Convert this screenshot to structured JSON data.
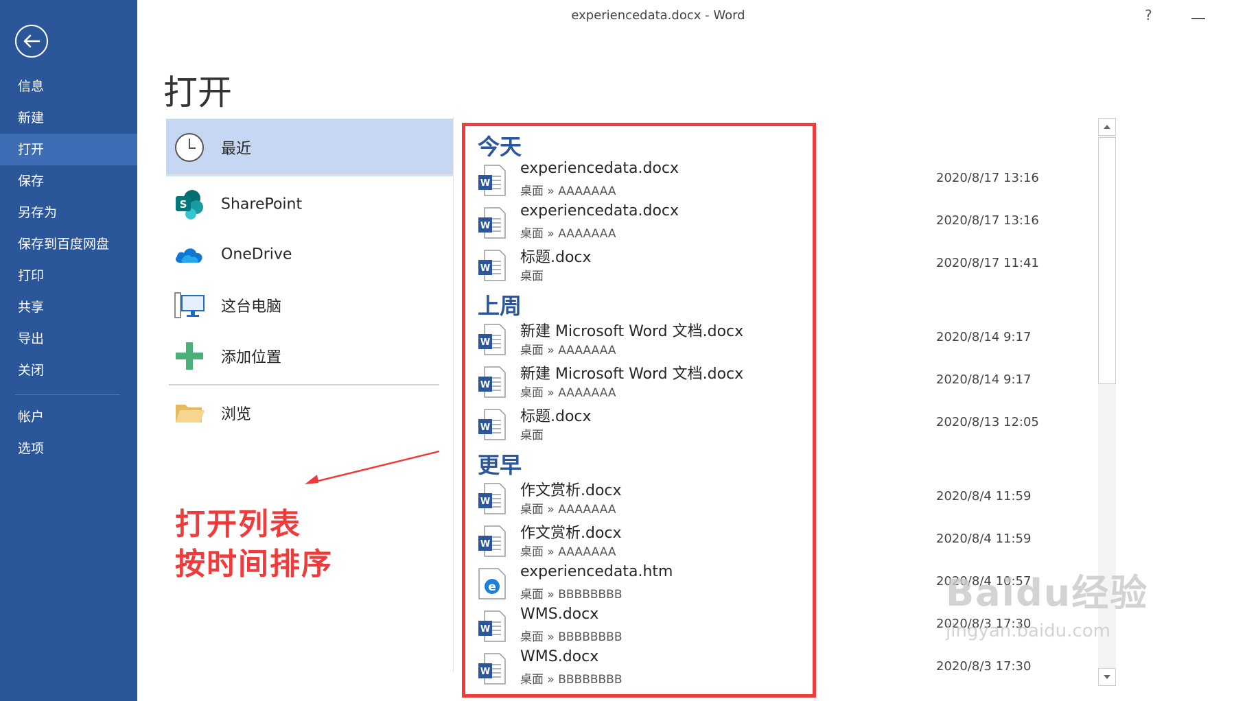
{
  "window": {
    "title": "experiencedata.docx - Word",
    "help": "?"
  },
  "nav": {
    "items": [
      {
        "label": "信息"
      },
      {
        "label": "新建"
      },
      {
        "label": "打开"
      },
      {
        "label": "保存"
      },
      {
        "label": "另存为"
      },
      {
        "label": "保存到百度网盘"
      },
      {
        "label": "打印"
      },
      {
        "label": "共享"
      },
      {
        "label": "导出"
      },
      {
        "label": "关闭"
      },
      {
        "label": "帐户"
      },
      {
        "label": "选项"
      }
    ],
    "active": "打开",
    "accent": "#2b579a"
  },
  "page": {
    "title": "打开"
  },
  "locations": [
    {
      "label": "最近",
      "icon": "clock-icon"
    },
    {
      "label": "SharePoint",
      "icon": "sharepoint-icon"
    },
    {
      "label": "OneDrive",
      "icon": "onedrive-icon"
    },
    {
      "label": "这台电脑",
      "icon": "computer-icon"
    },
    {
      "label": "添加位置",
      "icon": "plus-icon"
    },
    {
      "label": "浏览",
      "icon": "folder-icon"
    }
  ],
  "annotation": {
    "line1": "打开列表",
    "line2": "按时间排序",
    "color": "#ee3b3b"
  },
  "groups": [
    {
      "header": "今天"
    },
    {
      "header": "上周"
    },
    {
      "header": "更早"
    }
  ],
  "files": [
    {
      "name": "experiencedata.docx",
      "path": "桌面 » AAAAAAA",
      "date": "2020/8/17 13:16",
      "type": "word"
    },
    {
      "name": "experiencedata.docx",
      "path": "桌面 » AAAAAAA",
      "date": "2020/8/17 13:16",
      "type": "word"
    },
    {
      "name": "标题.docx",
      "path": "桌面",
      "date": "2020/8/17 11:41",
      "type": "word"
    },
    {
      "name": "新建 Microsoft Word 文档.docx",
      "path": "桌面 » AAAAAAA",
      "date": "2020/8/14 9:17",
      "type": "word"
    },
    {
      "name": "新建 Microsoft Word 文档.docx",
      "path": "桌面 » AAAAAAA",
      "date": "2020/8/14 9:17",
      "type": "word"
    },
    {
      "name": "标题.docx",
      "path": "桌面",
      "date": "2020/8/13 12:05",
      "type": "word"
    },
    {
      "name": "作文赏析.docx",
      "path": "桌面 » AAAAAAA",
      "date": "2020/8/4 11:59",
      "type": "word"
    },
    {
      "name": "作文赏析.docx",
      "path": "桌面 » AAAAAAA",
      "date": "2020/8/4 11:59",
      "type": "word"
    },
    {
      "name": "experiencedata.htm",
      "path": "桌面 » BBBBBBBB",
      "date": "2020/8/4 10:57",
      "type": "edge"
    },
    {
      "name": "WMS.docx",
      "path": "桌面 » BBBBBBBB",
      "date": "2020/8/3 17:30",
      "type": "word"
    },
    {
      "name": "WMS.docx",
      "path": "桌面 » BBBBBBBB",
      "date": "2020/8/3 17:30",
      "type": "word"
    }
  ],
  "watermark": {
    "logo": "Baidu经验",
    "url": "jingyan.baidu.com"
  }
}
